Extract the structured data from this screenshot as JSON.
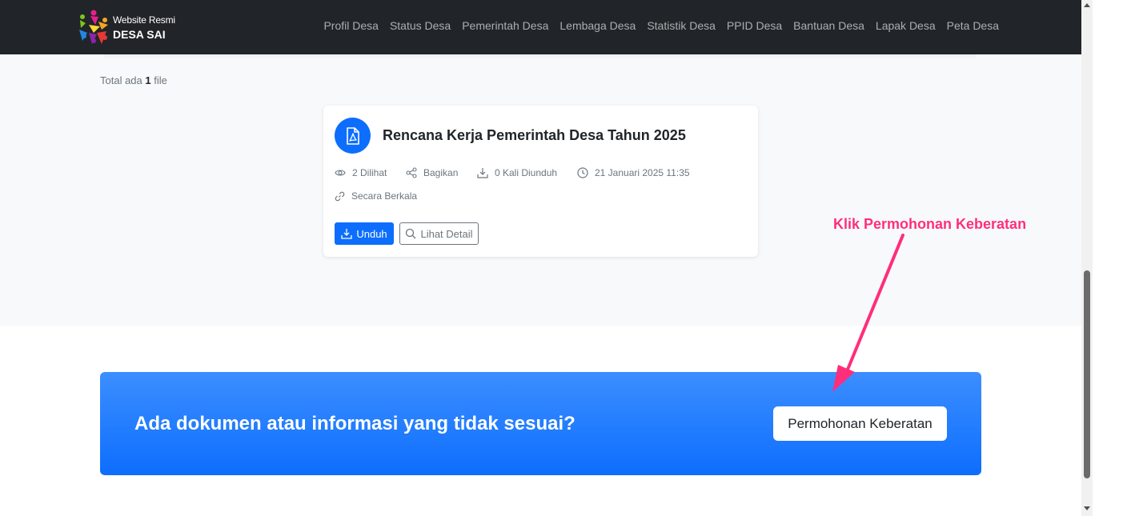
{
  "brand": {
    "subtitle": "Website Resmi",
    "name": "DESA SAI",
    "logo_icon": "village-people-logo-icon"
  },
  "nav": {
    "items": [
      {
        "label": "Profil Desa"
      },
      {
        "label": "Status Desa"
      },
      {
        "label": "Pemerintah Desa"
      },
      {
        "label": "Lembaga Desa"
      },
      {
        "label": "Statistik Desa"
      },
      {
        "label": "PPID Desa"
      },
      {
        "label": "Bantuan Desa"
      },
      {
        "label": "Lapak Desa"
      },
      {
        "label": "Peta Desa"
      }
    ]
  },
  "listing": {
    "total_prefix": "Total ada",
    "total_count": "1",
    "total_suffix": "file"
  },
  "document": {
    "icon": "pdf-file-icon",
    "title": "Rencana Kerja Pemerintah Desa Tahun 2025",
    "views": "2 Dilihat",
    "share": "Bagikan",
    "downloads": "0 Kali Diunduh",
    "date": "21 Januari 2025 11:35",
    "category": "Secara Berkala",
    "download_label": "Unduh",
    "detail_label": "Lihat Detail"
  },
  "banner": {
    "question": "Ada dokumen atau informasi yang tidak sesuai?",
    "button_label": "Permohonan Keberatan"
  },
  "annotation": {
    "text": "Klik Permohonan Keberatan"
  },
  "colors": {
    "navbar": "#212529",
    "primary": "#0d6efd",
    "annotation": "#ff2e7a",
    "section_bg": "#f8f9fa"
  }
}
